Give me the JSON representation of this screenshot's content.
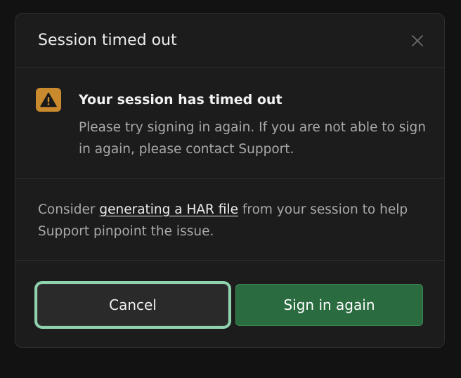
{
  "dialog": {
    "title": "Session timed out",
    "close_icon": "close-icon"
  },
  "alert": {
    "icon": "warning-triangle-icon",
    "title": "Your session has timed out",
    "body": "Please try signing in again. If you are not able to sign in again, please contact Support."
  },
  "har": {
    "prefix": "Consider ",
    "link_text": "generating a HAR file",
    "suffix": " from your session to help Support pinpoint the issue."
  },
  "actions": {
    "cancel_label": "Cancel",
    "signin_label": "Sign in again"
  },
  "colors": {
    "background": "#121212",
    "dialog": "#1c1c1c",
    "warning": "#c98a2e",
    "primary": "#2a6b3f",
    "focus_ring": "#8fd3ae"
  }
}
